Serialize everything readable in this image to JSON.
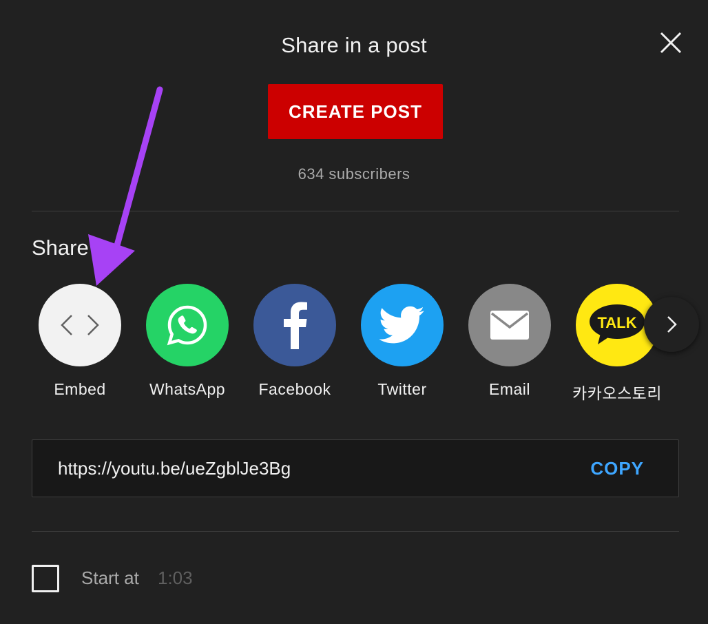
{
  "dialog": {
    "title": "Share in a post",
    "create_post_label": "CREATE POST",
    "subscribers": "634 subscribers",
    "close_icon": "close-icon"
  },
  "share": {
    "heading": "Share",
    "items": [
      {
        "label": "Embed",
        "icon": "embed-code-icon",
        "bg": "#f2f2f2"
      },
      {
        "label": "WhatsApp",
        "icon": "whatsapp-icon",
        "bg": "#25d366"
      },
      {
        "label": "Facebook",
        "icon": "facebook-icon",
        "bg": "#3b5998"
      },
      {
        "label": "Twitter",
        "icon": "twitter-icon",
        "bg": "#1da1f2"
      },
      {
        "label": "Email",
        "icon": "email-icon",
        "bg": "#888888"
      },
      {
        "label": "카카오스토리",
        "icon": "kakaotalk-icon",
        "bg": "#ffe812",
        "icon_text": "TALK"
      }
    ],
    "next_icon": "chevron-right-icon"
  },
  "url_box": {
    "url": "https://youtu.be/ueZgblJe3Bg",
    "copy_label": "COPY"
  },
  "start_at": {
    "label": "Start at",
    "time": "1:03",
    "checked": false
  },
  "annotation": {
    "arrow_color": "#a742f5",
    "arrow_icon": "purple-arrow-annotation"
  },
  "colors": {
    "background": "#212121",
    "accent_red": "#cc0000",
    "link_blue": "#3ea6ff"
  }
}
